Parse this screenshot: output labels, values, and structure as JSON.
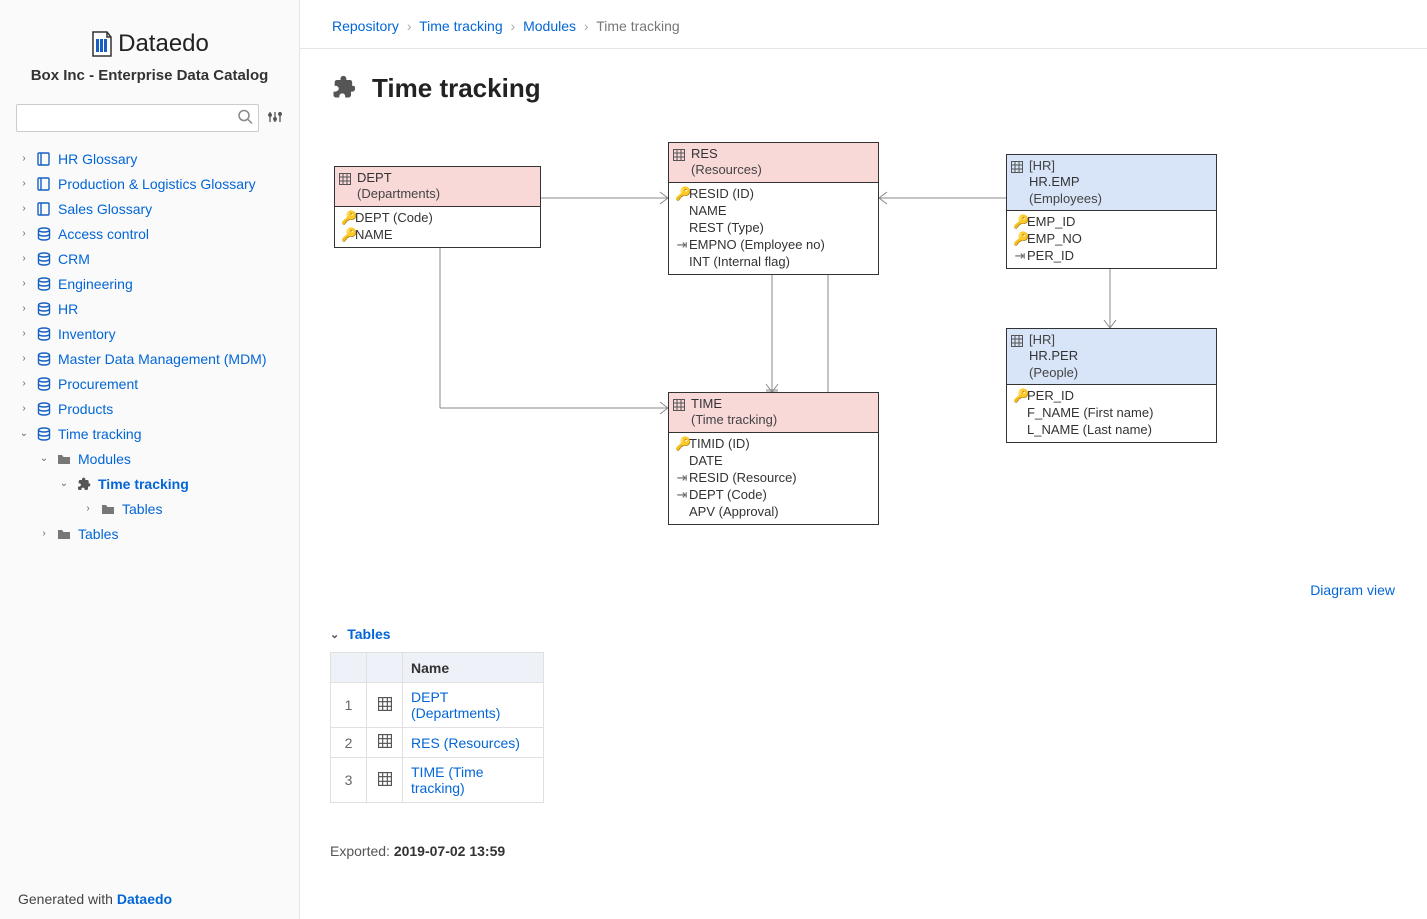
{
  "brand": {
    "name": "Dataedo",
    "subtitle": "Box Inc - Enterprise Data Catalog"
  },
  "search": {
    "placeholder": ""
  },
  "sidebar": {
    "items": [
      {
        "label": "HR Glossary",
        "icon": "book"
      },
      {
        "label": "Production & Logistics Glossary",
        "icon": "book"
      },
      {
        "label": "Sales Glossary",
        "icon": "book"
      },
      {
        "label": "Access control",
        "icon": "db"
      },
      {
        "label": "CRM",
        "icon": "db"
      },
      {
        "label": "Engineering",
        "icon": "db"
      },
      {
        "label": "HR",
        "icon": "db"
      },
      {
        "label": "Inventory",
        "icon": "db"
      },
      {
        "label": "Master Data Management (MDM)",
        "icon": "db"
      },
      {
        "label": "Procurement",
        "icon": "db"
      },
      {
        "label": "Products",
        "icon": "db"
      },
      {
        "label": "Time tracking",
        "icon": "db",
        "expanded": true
      }
    ],
    "tt": {
      "modules": "Modules",
      "module_name": "Time tracking",
      "sub_tables": "Tables",
      "tables": "Tables"
    }
  },
  "footer": {
    "prefix": "Generated with ",
    "brand": "Dataedo"
  },
  "crumbs": [
    "Repository",
    "Time tracking",
    "Modules",
    "Time tracking"
  ],
  "page": {
    "title": "Time tracking",
    "diagram_link": "Diagram view"
  },
  "entities": {
    "dept": {
      "title": "DEPT",
      "sub": "(Departments)",
      "cols": [
        {
          "k": "gold",
          "t": "DEPT (Code)"
        },
        {
          "k": "gold",
          "t": "NAME"
        }
      ]
    },
    "res": {
      "title": "RES",
      "sub": "(Resources)",
      "cols": [
        {
          "k": "gold",
          "t": "RESID (ID)"
        },
        {
          "k": "",
          "t": "NAME"
        },
        {
          "k": "",
          "t": "REST (Type)"
        },
        {
          "k": "fk",
          "t": "EMPNO (Employee no)"
        },
        {
          "k": "",
          "t": "INT (Internal flag)"
        }
      ]
    },
    "time": {
      "title": "TIME",
      "sub": "(Time tracking)",
      "cols": [
        {
          "k": "gold",
          "t": "TIMID (ID)"
        },
        {
          "k": "",
          "t": "DATE"
        },
        {
          "k": "fk",
          "t": "RESID (Resource)"
        },
        {
          "k": "fk",
          "t": "DEPT (Code)"
        },
        {
          "k": "",
          "t": "APV (Approval)"
        }
      ]
    },
    "emp": {
      "schema": "[HR]",
      "title": "HR.EMP",
      "sub": "(Employees)",
      "cols": [
        {
          "k": "gold",
          "t": "EMP_ID"
        },
        {
          "k": "blue",
          "t": "EMP_NO"
        },
        {
          "k": "fk",
          "t": "PER_ID"
        }
      ]
    },
    "per": {
      "schema": "[HR]",
      "title": "HR.PER",
      "sub": "(People)",
      "cols": [
        {
          "k": "gold",
          "t": "PER_ID"
        },
        {
          "k": "",
          "t": "F_NAME (First name)"
        },
        {
          "k": "",
          "t": "L_NAME (Last name)"
        }
      ]
    }
  },
  "tables_section": {
    "heading": "Tables",
    "header": "Name",
    "rows": [
      {
        "n": "1",
        "label": "DEPT (Departments)"
      },
      {
        "n": "2",
        "label": "RES (Resources)"
      },
      {
        "n": "3",
        "label": "TIME (Time tracking)"
      }
    ]
  },
  "exported": {
    "prefix": "Exported: ",
    "ts": "2019-07-02 13:59"
  }
}
